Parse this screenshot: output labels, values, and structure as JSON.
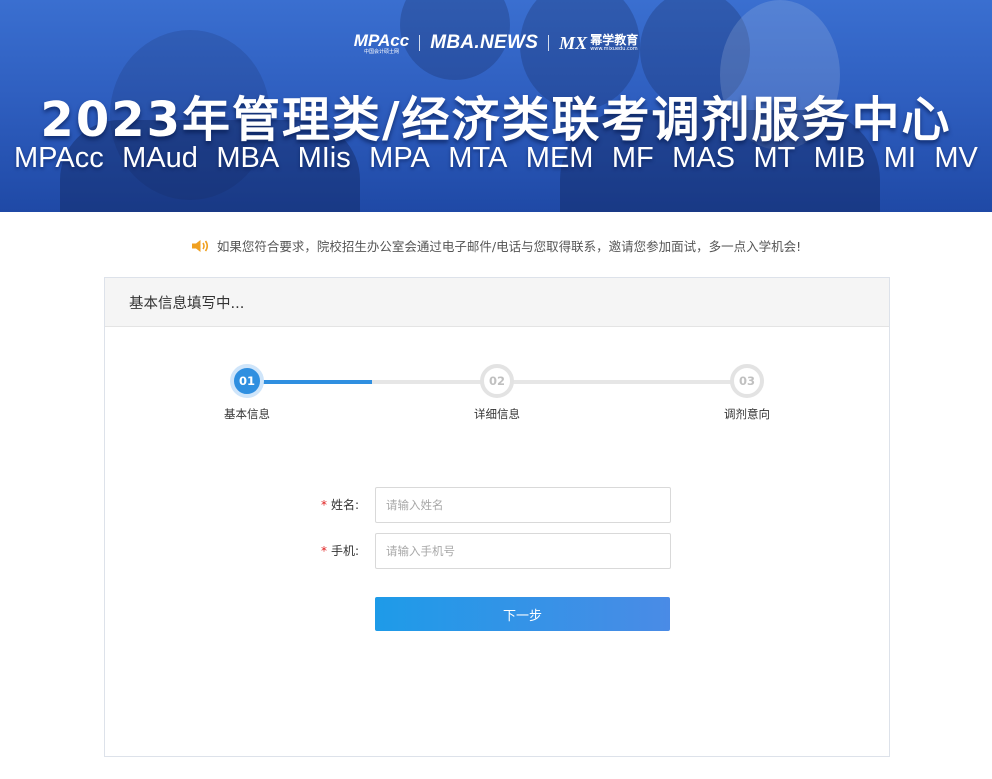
{
  "banner": {
    "logos": {
      "mpacc": "MPAcc",
      "mpacc_sub": "中国会计硕士网",
      "mbanews": "MBA.NEWS",
      "mx_mark": "MX",
      "mx_name": "幂学教育",
      "mx_url": "www.mixuedu.com"
    },
    "title": "2023年管理类/经济类联考调剂服务中心",
    "programs": [
      "MPAcc",
      "MAud",
      "MBA",
      "MIis",
      "MPA",
      "MTA",
      "MEM",
      "MF",
      "MAS",
      "MT",
      "MIB",
      "MI",
      "MV"
    ]
  },
  "notice": {
    "icon": "speaker-icon",
    "text": "如果您符合要求，院校招生办公室会通过电子邮件/电话与您取得联系，邀请您参加面试，多一点入学机会!"
  },
  "card": {
    "title": "基本信息填写中...",
    "steps": [
      {
        "number": "01",
        "label": "基本信息",
        "state": "active"
      },
      {
        "number": "02",
        "label": "详细信息",
        "state": "inactive"
      },
      {
        "number": "03",
        "label": "调剂意向",
        "state": "inactive"
      }
    ],
    "progress_fraction": 0.25,
    "form": {
      "name": {
        "required_mark": "*",
        "label": "姓名:",
        "placeholder": "请输入姓名",
        "value": ""
      },
      "phone": {
        "required_mark": "*",
        "label": "手机:",
        "placeholder": "请输入手机号",
        "value": ""
      },
      "next_label": "下一步"
    }
  },
  "colors": {
    "accent": "#2f8fe0",
    "required": "#e02020",
    "banner": "#2f5fc0"
  }
}
